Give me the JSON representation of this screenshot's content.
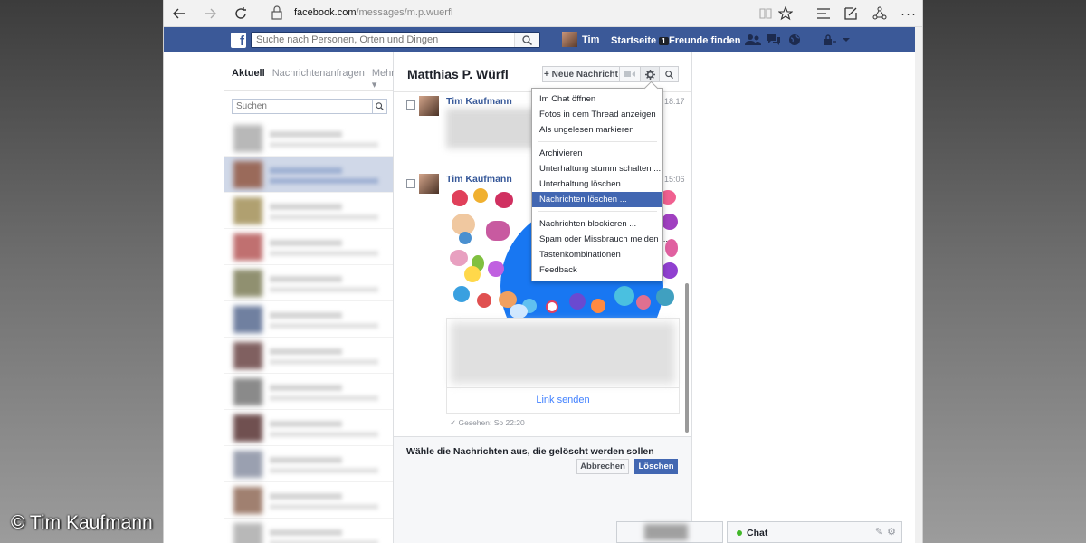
{
  "watermark": "© Tim Kaufmann",
  "browser": {
    "url_domain": "facebook.com",
    "url_path": "/messages/m.p.wuerfl",
    "nav": {
      "back_icon": "arrow-left-icon",
      "forward_icon": "arrow-right-icon",
      "reload_icon": "reload-icon"
    },
    "toolbar_icons": [
      "reading-view-icon",
      "favorite-star-icon",
      "hub-icon",
      "web-note-icon",
      "share-icon",
      "more-icon"
    ]
  },
  "fb_bar": {
    "search_placeholder": "Suche nach Personen, Orten und Dingen",
    "user_name": "Tim",
    "home_label": "Startseite",
    "home_badge": "1",
    "find_friends_label": "Freunde finden",
    "icons": [
      "friend-requests-icon",
      "messages-icon",
      "notifications-globe-icon",
      "privacy-lock-icon",
      "account-menu-caret-icon"
    ]
  },
  "left": {
    "tabs": [
      {
        "label": "Aktuell",
        "active": true
      },
      {
        "label": "Nachrichtenanfragen",
        "active": false
      },
      {
        "label": "Mehr ▾",
        "active": false
      }
    ],
    "search_placeholder": "Suchen",
    "conversations_count_visible": 11,
    "selected_index": 1
  },
  "thread": {
    "title": "Matthias P. Würfl",
    "new_message_label": "+ Neue Nachricht",
    "messages": [
      {
        "sender": "Tim Kaufmann",
        "time": "18:17"
      },
      {
        "sender": "Tim Kaufmann",
        "time": "15:06"
      }
    ],
    "link_send_label": "Link senden",
    "seen_text": "✓ Gesehen: So 22:20"
  },
  "dropdown": {
    "groups": [
      [
        "Im Chat öffnen",
        "Fotos in dem Thread anzeigen",
        "Als ungelesen markieren"
      ],
      [
        "Archivieren",
        "Unterhaltung stumm schalten ...",
        "Unterhaltung löschen ...",
        "Nachrichten löschen ..."
      ],
      [
        "Nachrichten blockieren ...",
        "Spam oder Missbrauch melden ...",
        "Tastenkombinationen",
        "Feedback"
      ]
    ],
    "highlighted": "Nachrichten löschen ..."
  },
  "delete_bar": {
    "prompt": "Wähle die Nachrichten aus, die gelöscht werden sollen",
    "cancel_label": "Abbrechen",
    "delete_label": "Löschen"
  },
  "chat": {
    "label": "Chat",
    "status_color": "#42b72a"
  },
  "colors": {
    "fb_blue": "#3b5998",
    "highlight": "#4267b2",
    "link": "#365899"
  }
}
